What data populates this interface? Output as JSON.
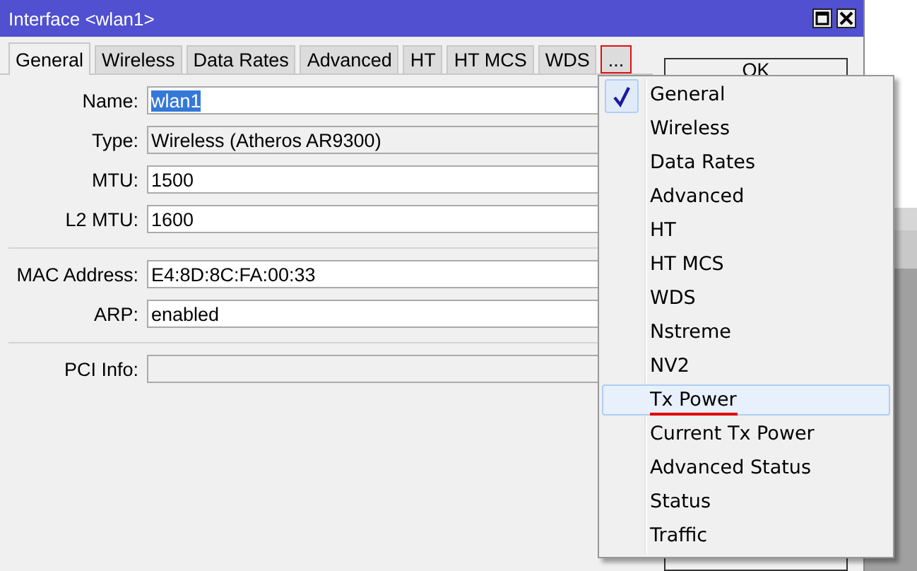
{
  "window": {
    "title": "Interface <wlan1>"
  },
  "tabs": [
    {
      "label": "General",
      "selected": true,
      "highlighted": false
    },
    {
      "label": "Wireless",
      "selected": false,
      "highlighted": false
    },
    {
      "label": "Data Rates",
      "selected": false,
      "highlighted": false
    },
    {
      "label": "Advanced",
      "selected": false,
      "highlighted": false
    },
    {
      "label": "HT",
      "selected": false,
      "highlighted": false
    },
    {
      "label": "HT MCS",
      "selected": false,
      "highlighted": false
    },
    {
      "label": "WDS",
      "selected": false,
      "highlighted": false
    },
    {
      "label": "...",
      "selected": false,
      "highlighted": true
    }
  ],
  "field_groups": [
    [
      {
        "label": "Name:",
        "value": "wlan1",
        "value_selected": true,
        "disabled": false
      },
      {
        "label": "Type:",
        "value": "Wireless (Atheros AR9300)",
        "value_selected": false,
        "disabled": true
      },
      {
        "label": "MTU:",
        "value": "1500",
        "value_selected": false,
        "disabled": false
      },
      {
        "label": "L2 MTU:",
        "value": "1600",
        "value_selected": false,
        "disabled": false
      }
    ],
    [
      {
        "label": "MAC Address:",
        "value": "E4:8D:8C:FA:00:33",
        "value_selected": false,
        "disabled": false
      },
      {
        "label": "ARP:",
        "value": "enabled",
        "value_selected": false,
        "disabled": false
      }
    ],
    [
      {
        "label": "PCI Info:",
        "disabled": true
      }
    ]
  ],
  "buttons": [
    "OK"
  ],
  "menu": {
    "items": [
      {
        "label": "General",
        "checked": true,
        "selected": false,
        "annotated": false
      },
      {
        "label": "Wireless",
        "checked": false,
        "selected": false,
        "annotated": false
      },
      {
        "label": "Data Rates",
        "checked": false,
        "selected": false,
        "annotated": false
      },
      {
        "label": "Advanced",
        "checked": false,
        "selected": false,
        "annotated": false
      },
      {
        "label": "HT",
        "checked": false,
        "selected": false,
        "annotated": false
      },
      {
        "label": "HT MCS",
        "checked": false,
        "selected": false,
        "annotated": false
      },
      {
        "label": "WDS",
        "checked": false,
        "selected": false,
        "annotated": false
      },
      {
        "label": "Nstreme",
        "checked": false,
        "selected": false,
        "annotated": false
      },
      {
        "label": "NV2",
        "checked": false,
        "selected": false,
        "annotated": false
      },
      {
        "label": "Tx Power",
        "checked": false,
        "selected": true,
        "annotated": true
      },
      {
        "label": "Current Tx Power",
        "checked": false,
        "selected": false,
        "annotated": false
      },
      {
        "label": "Advanced Status",
        "checked": false,
        "selected": false,
        "annotated": false
      },
      {
        "label": "Status",
        "checked": false,
        "selected": false,
        "annotated": false
      },
      {
        "label": "Traffic",
        "checked": false,
        "selected": false,
        "annotated": false
      }
    ]
  }
}
